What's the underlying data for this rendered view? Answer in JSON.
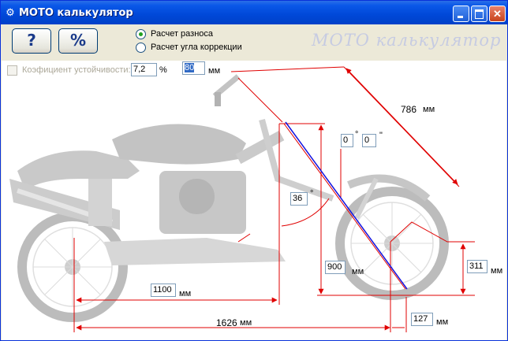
{
  "window": {
    "title": "МОТО калькулятор",
    "icon": "gear-icon",
    "controls": {
      "minimize": "minimize-icon",
      "maximize": "maximize-icon",
      "close": "close-icon"
    }
  },
  "toolbar": {
    "help_label": "?",
    "percent_label": "%",
    "mode_options": [
      {
        "label": "Расчет разноса",
        "selected": true
      },
      {
        "label": "Расчет угла коррекции",
        "selected": false
      }
    ],
    "watermark": "МОТО калькулятор"
  },
  "stability": {
    "label": "Коэфициент устойчивости:",
    "checked": false,
    "value": "7,2",
    "unit": "%"
  },
  "inputs": {
    "top_offset": {
      "value": "80",
      "unit": "мм"
    },
    "fork_length": {
      "value": "786",
      "unit": "мм"
    },
    "correction_deg": {
      "value": "0",
      "unit": "°"
    },
    "correction_min": {
      "value": "0",
      "unit": "\""
    },
    "rake_angle": {
      "value": "36",
      "unit": "°"
    },
    "height": {
      "value": "900",
      "unit": "мм"
    },
    "wheel_radius": {
      "value": "311",
      "unit": "мм"
    },
    "rear_dist": {
      "value": "1100",
      "unit": "мм"
    },
    "wheelbase": {
      "value": "1626",
      "unit": "мм"
    },
    "trail": {
      "value": "127",
      "unit": "мм"
    }
  },
  "colors": {
    "title_bar": "#0a58e8",
    "dimension_red": "#e00000",
    "fork_blue": "#1010e0",
    "motorcycle_gray": "#c8c8c8"
  }
}
